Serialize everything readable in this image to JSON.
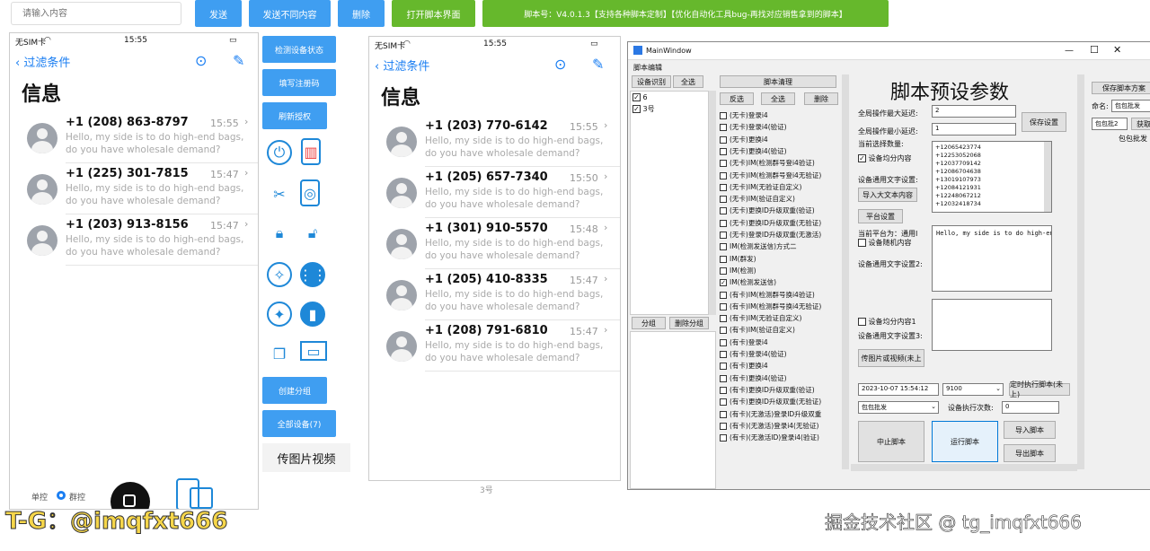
{
  "toolbar": {
    "placeholder": "请输入内容",
    "send": "发送",
    "send_diff": "发送不同内容",
    "delete": "删除",
    "open_script": "打开脚本界面",
    "version_banner": "脚本号：V4.0.1.3【支持各种脚本定制】【优化自动化工具bug-再找对应销售拿到的脚本】"
  },
  "phone_left": {
    "carrier": "无SIM卡",
    "time": "15:55",
    "back_label": "过滤条件",
    "title": "信息",
    "messages": [
      {
        "name": "+1 (208) 863-8797",
        "time": "15:55",
        "line1": "Hello, my side is to do high-end bags,",
        "line2": "do you have wholesale demand?"
      },
      {
        "name": "+1 (225) 301-7815",
        "time": "15:47",
        "line1": "Hello, my side is to do high-end bags,",
        "line2": "do you have wholesale demand?"
      },
      {
        "name": "+1 (203) 913-8156",
        "time": "15:47",
        "line1": "Hello, my side is to do high-end bags,",
        "line2": "do you have wholesale demand?"
      }
    ],
    "bottom_left": "单控",
    "bottom_mid": "群控"
  },
  "middle": {
    "btn1": "检测设备状态",
    "btn2": "填写注册码",
    "btn3": "刷新授权",
    "btn4": "创建分组",
    "btn5": "全部设备(7)",
    "btn6": "传图片视频"
  },
  "phone_right": {
    "carrier": "无SIM卡",
    "time": "15:55",
    "back_label": "过滤条件",
    "title": "信息",
    "messages": [
      {
        "name": "+1 (203) 770-6142",
        "time": "15:55",
        "line1": "Hello, my side is to do high-end bags,",
        "line2": "do you have wholesale demand?"
      },
      {
        "name": "+1 (205) 657-7340",
        "time": "15:50",
        "line1": "Hello, my side is to do high-end bags,",
        "line2": "do you have wholesale demand?"
      },
      {
        "name": "+1 (301) 910-5570",
        "time": "15:48",
        "line1": "Hello, my side is to do high-end bags,",
        "line2": "do you have wholesale demand?"
      },
      {
        "name": "+1 (205) 410-8335",
        "time": "15:47",
        "line1": "Hello, my side is to do high-end bags,",
        "line2": "do you have wholesale demand?"
      },
      {
        "name": "+1 (208) 791-6810",
        "time": "15:47",
        "line1": "Hello, my side is to do high-end bags,",
        "line2": "do you have wholesale demand?"
      }
    ],
    "footer": "3号"
  },
  "window": {
    "title": "MainWindow",
    "menu": "脚本编辑",
    "device_identify": "设备识别",
    "select_all": "全选",
    "devices": [
      "6",
      "3号"
    ],
    "group": "分组",
    "delete_group": "删除分组",
    "script_list_header": "脚本清理",
    "invert": "反选",
    "select_all2": "全选",
    "delete": "删除",
    "scripts": [
      "(无卡)登录i4",
      "(无卡)登录i4(验证)",
      "(无卡)更换i4",
      "(无卡)更换i4(验证)",
      "(无卡)IM(检测群号登i4验证)",
      "(无卡)IM(检测群号登i4无验证)",
      "(无卡)IM(无验证自定义)",
      "(无卡)IM(验证自定义)",
      "(无卡)更换ID升级双重(验证)",
      "(无卡)更换ID升级双重(无验证)",
      "(无卡)登录ID升级双重(无激活)",
      "IM(检测发送信)方式二",
      "IM(群发)",
      "IM(检测)",
      "IM(检测发送信)",
      "(有卡)IM(检测群号换i4验证)",
      "(有卡)IM(检测群号换i4无验证)",
      "(有卡)IM(无验证自定义)",
      "(有卡)IM(验证自定义)",
      "(有卡)登录i4",
      "(有卡)登录i4(验证)",
      "(有卡)更换i4",
      "(有卡)更换i4(验证)",
      "(有卡)更换ID升级双重(验证)",
      "(有卡)更换ID升级双重(无验证)",
      "(有卡)(无激活)登录ID升级双重",
      "(有卡)(无激活)登录i4(无验证)",
      "(有卡)(无激活ID)登录i4(验证)"
    ],
    "checked_script_index": 14,
    "heading": "脚本预设参数",
    "max_delay_label": "全局操作最大延迟:",
    "max_delay_value": "2",
    "min_delay_label": "全局操作最小延迟:",
    "min_delay_value": "1",
    "save_settings": "保存设置",
    "current_count_label": "当前选择数量:",
    "numbers": [
      "+12065423774",
      "+12253052068",
      "+12037709142",
      "+12086704638",
      "+13019107973",
      "+12084121931",
      "+12248067212",
      "+12032418734"
    ],
    "even_content": "设备均分内容",
    "common_text1": "设备通用文字设置:",
    "import_text": "导入大文本内容",
    "platform_settings": "平台设置",
    "current_platform": "当前平台为：通用I",
    "random_content": "设备随机内容",
    "common_text2": "设备通用文字设置2:",
    "text_area": "Hello, my side is to do high-end",
    "even_content1": "设备均分内容1",
    "common_text3": "设备通用文字设置3:",
    "upload_media": "传图片或视频(未上",
    "datetime": "2023-10-07 15:54:12",
    "select_value": "9100",
    "timed_run": "定时执行脚本(未上)",
    "bag_wholesale": "包包批发",
    "exec_count_label": "设备执行次数:",
    "exec_count_value": "0",
    "stop_script": "中止脚本",
    "run_script": "运行脚本",
    "import_script": "导入脚本",
    "export_script": "导出脚本",
    "save_template": "保存脚本方案",
    "name_label": "命名:",
    "name_value": "包包批发",
    "combo_value": "包包批2",
    "extra_btn": "获取",
    "bag_wholesale2": "包包批发"
  },
  "watermarks": {
    "left": "T-G：@imqfxt666",
    "right": "掘金技术社区 @ tg_imqfxt666"
  },
  "colors": {
    "accent_blue": "#3f9ef1",
    "accent_green": "#66b82c",
    "link_blue": "#1a7ef2"
  }
}
